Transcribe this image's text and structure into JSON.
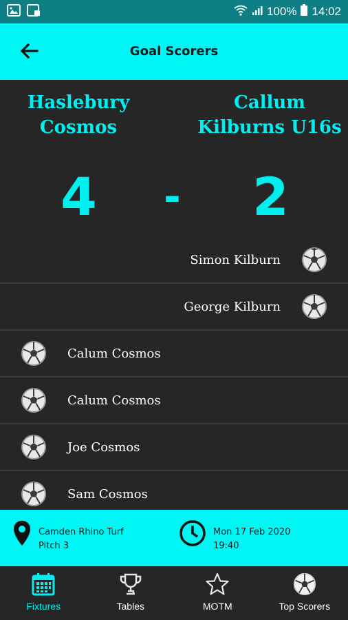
{
  "status_bar": {
    "battery_pct": "100%",
    "time": "14:02",
    "left_icons": [
      "gallery-icon",
      "screenshot-icon"
    ],
    "right_icons": [
      "wifi-icon",
      "signal-icon",
      "battery-icon"
    ]
  },
  "app_bar": {
    "title": "Goal Scorers",
    "back_icon": "back-arrow-icon",
    "color": "#00F5F5"
  },
  "match": {
    "home_team_line1": "Haslebury",
    "home_team_line2": "Cosmos",
    "away_team_line1": "Callum",
    "away_team_line2": "Kilburns U16s",
    "home_score": "4",
    "separator": "-",
    "away_score": "2",
    "accent_color": "#00F0F0"
  },
  "scorers": [
    {
      "name": "Simon Kilburn",
      "side": "away",
      "icon": "football-icon"
    },
    {
      "name": "George Kilburn",
      "side": "away",
      "icon": "football-icon"
    },
    {
      "name": "Calum Cosmos",
      "side": "home",
      "icon": "football-icon"
    },
    {
      "name": "Calum Cosmos",
      "side": "home",
      "icon": "football-icon"
    },
    {
      "name": "Joe Cosmos",
      "side": "home",
      "icon": "football-icon"
    },
    {
      "name": "Sam Cosmos",
      "side": "home",
      "icon": "football-icon"
    }
  ],
  "venue": {
    "location_icon": "location-pin-icon",
    "venue_line1": "Camden Rhino Turf",
    "venue_line2": "Pitch 3",
    "time_icon": "clock-icon",
    "date": "Mon 17 Feb 2020",
    "time": "19:40"
  },
  "bottom_nav": {
    "items": [
      {
        "label": "Fixtures",
        "icon": "calendar-icon",
        "active": true
      },
      {
        "label": "Tables",
        "icon": "trophy-icon",
        "active": false
      },
      {
        "label": "MOTM",
        "icon": "star-icon",
        "active": false
      },
      {
        "label": "Top Scorers",
        "icon": "football-icon",
        "active": false
      }
    ]
  }
}
